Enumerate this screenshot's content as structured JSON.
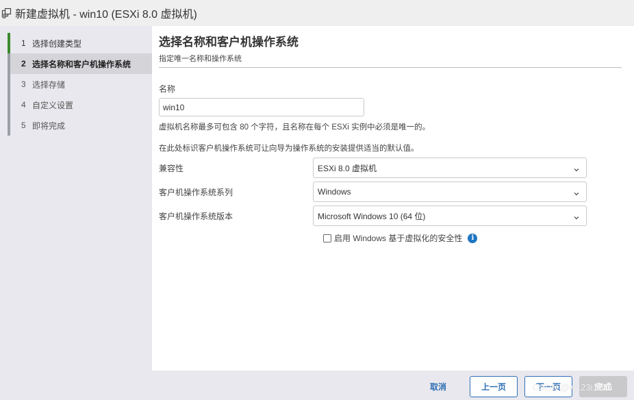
{
  "window": {
    "title": "新建虚拟机 - win10 (ESXi 8.0 虚拟机)",
    "icon": "vm-copy-icon"
  },
  "sidebar": {
    "steps": [
      {
        "num": "1",
        "label": "选择创建类型",
        "state": "done"
      },
      {
        "num": "2",
        "label": "选择名称和客户机操作系统",
        "state": "active"
      },
      {
        "num": "3",
        "label": "选择存储",
        "state": "pending"
      },
      {
        "num": "4",
        "label": "自定义设置",
        "state": "pending"
      },
      {
        "num": "5",
        "label": "即将完成",
        "state": "pending"
      }
    ]
  },
  "main": {
    "title": "选择名称和客户机操作系统",
    "subtitle": "指定唯一名称和操作系统",
    "name_label": "名称",
    "name_value": "win10",
    "name_hint": "虚拟机名称最多可包含 80 个字符，且名称在每个 ESXi 实例中必须是唯一的。",
    "os_hint": "在此处标识客户机操作系统可让向导为操作系统的安装提供适当的默认值。",
    "fields": [
      {
        "label": "兼容性",
        "value": "ESXi 8.0 虚拟机"
      },
      {
        "label": "客户机操作系统系列",
        "value": "Windows"
      },
      {
        "label": "客户机操作系统版本",
        "value": "Microsoft Windows 10 (64 位)"
      }
    ],
    "vbs_checkbox_label": "启用 Windows 基于虚拟化的安全性",
    "vbs_checked": false
  },
  "footer": {
    "cancel": "取消",
    "prev": "上一页",
    "next": "下一页",
    "finish": "完成"
  },
  "watermark": "CSDN @w123i123h",
  "colors": {
    "accent": "#2f6fb5",
    "step_done": "#3c8a2e",
    "info": "#1f76c2"
  }
}
